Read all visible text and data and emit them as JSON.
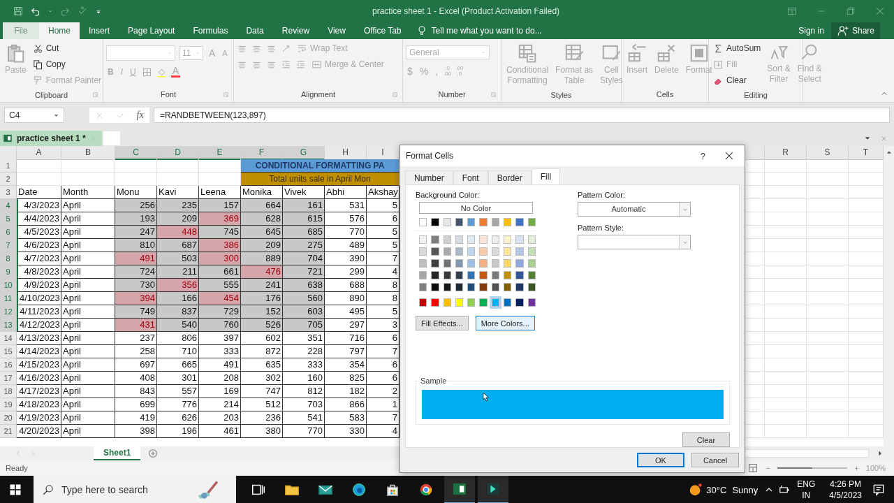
{
  "window": {
    "title": "practice sheet 1 - Excel (Product Activation Failed)"
  },
  "ribbon_tabs": [
    {
      "label": "File",
      "selected": false,
      "disabled": true
    },
    {
      "label": "Home",
      "selected": true,
      "disabled": false
    },
    {
      "label": "Insert",
      "selected": false,
      "disabled": false
    },
    {
      "label": "Page Layout",
      "selected": false,
      "disabled": false
    },
    {
      "label": "Formulas",
      "selected": false,
      "disabled": false
    },
    {
      "label": "Data",
      "selected": false,
      "disabled": false
    },
    {
      "label": "Review",
      "selected": false,
      "disabled": false
    },
    {
      "label": "View",
      "selected": false,
      "disabled": false
    },
    {
      "label": "Office Tab",
      "selected": false,
      "disabled": false
    }
  ],
  "tell_me": {
    "placeholder": "Tell me what you want to do..."
  },
  "account": {
    "sign_in": "Sign in",
    "share": "Share"
  },
  "ribbon": {
    "clipboard": {
      "label": "Clipboard",
      "paste": {
        "label": "Paste",
        "disabled": true
      },
      "items": [
        {
          "kind": "cut",
          "label": "Cut",
          "disabled": false
        },
        {
          "kind": "copy",
          "label": "Copy",
          "disabled": false
        },
        {
          "kind": "painter",
          "label": "Format Painter",
          "disabled": true
        }
      ]
    },
    "font": {
      "label": "Font",
      "size": "11",
      "size_buttons": [
        {
          "kind": "grow",
          "label": "A"
        },
        {
          "kind": "shrink",
          "label": "A"
        }
      ],
      "style_buttons": [
        {
          "kind": "bold",
          "label": "B"
        },
        {
          "kind": "italic",
          "label": "I"
        },
        {
          "kind": "underline",
          "label": "U"
        }
      ],
      "color_button": {
        "label": "A"
      }
    },
    "alignment": {
      "label": "Alignment",
      "wrap": {
        "label": "Wrap Text"
      },
      "merge": {
        "label": "Merge & Center"
      }
    },
    "number": {
      "label": "Number",
      "format": "General",
      "symbols": [
        {
          "label": "$"
        },
        {
          "label": "%"
        },
        {
          "label": ","
        }
      ],
      "decimals": [
        {
          "top": ".0",
          "bottom": ".00"
        },
        {
          "top": ".00",
          "bottom": ".0"
        }
      ]
    },
    "styles": {
      "label": "Styles",
      "items": [
        {
          "kind": "conditional",
          "label": "Conditional\nFormatting"
        },
        {
          "kind": "table",
          "label": "Format as\nTable"
        },
        {
          "kind": "cellstyles",
          "label": "Cell\nStyles"
        }
      ]
    },
    "cells": {
      "label": "Cells",
      "items": [
        {
          "kind": "insert",
          "label": "Insert"
        },
        {
          "kind": "delete",
          "label": "Delete"
        },
        {
          "kind": "format",
          "label": "Format"
        }
      ]
    },
    "editing": {
      "label": "Editing",
      "items": [
        {
          "kind": "autosum",
          "label": "AutoSum",
          "disabled": false
        },
        {
          "kind": "fill",
          "label": "Fill",
          "disabled": true
        },
        {
          "kind": "clear",
          "label": "Clear",
          "disabled": false
        }
      ],
      "big": [
        {
          "kind": "sort",
          "label": "Sort &\nFilter"
        },
        {
          "kind": "find",
          "label": "Find &\nSelect"
        }
      ]
    }
  },
  "formula_bar": {
    "name_box": "C4",
    "fx": "fx",
    "formula": "=RANDBETWEEN(123,897)"
  },
  "document_tab": {
    "title": "practice sheet 1 *"
  },
  "columns": [
    {
      "label": "A",
      "selected": false
    },
    {
      "label": "B",
      "selected": false
    },
    {
      "label": "C",
      "selected": true
    },
    {
      "label": "D",
      "selected": true
    },
    {
      "label": "E",
      "selected": true
    },
    {
      "label": "F",
      "selected": true
    },
    {
      "label": "G",
      "selected": true
    },
    {
      "label": "H",
      "selected": false
    },
    {
      "label": "I",
      "selected": false
    }
  ],
  "right_columns": [
    {
      "label": "R"
    },
    {
      "label": "S"
    },
    {
      "label": "T"
    }
  ],
  "banner_rows": [
    {
      "row": "1",
      "text": "CONDITIONAL FORMATTING PA",
      "color": "#5b9bd5"
    },
    {
      "row": "2",
      "text": "Total units sale in April Mon",
      "color": "#bf8f00"
    }
  ],
  "header_row": {
    "row": "3",
    "labels": [
      "Date",
      "Month",
      "Monu",
      "Kavi",
      "Leena",
      "Monika",
      "Vivek",
      "Abhi",
      "Akshay"
    ]
  },
  "rows": [
    {
      "row": "4",
      "selected": true,
      "date": "4/3/2023",
      "month": "April",
      "cells": [
        {
          "value": "256",
          "selected": true,
          "flagged": false
        },
        {
          "value": "235",
          "selected": true,
          "flagged": false
        },
        {
          "value": "157",
          "selected": true,
          "flagged": false
        },
        {
          "value": "664",
          "selected": true,
          "flagged": false
        },
        {
          "value": "161",
          "selected": true,
          "flagged": false
        },
        {
          "value": "531",
          "selected": false,
          "flagged": false
        },
        {
          "value": "5",
          "selected": false,
          "flagged": false
        }
      ]
    },
    {
      "row": "5",
      "selected": true,
      "date": "4/4/2023",
      "month": "April",
      "cells": [
        {
          "value": "193",
          "selected": true,
          "flagged": false
        },
        {
          "value": "209",
          "selected": true,
          "flagged": false
        },
        {
          "value": "369",
          "selected": true,
          "flagged": true
        },
        {
          "value": "628",
          "selected": true,
          "flagged": false
        },
        {
          "value": "615",
          "selected": true,
          "flagged": false
        },
        {
          "value": "576",
          "selected": false,
          "flagged": false
        },
        {
          "value": "6",
          "selected": false,
          "flagged": false
        }
      ]
    },
    {
      "row": "6",
      "selected": true,
      "date": "4/5/2023",
      "month": "April",
      "cells": [
        {
          "value": "247",
          "selected": true,
          "flagged": false
        },
        {
          "value": "448",
          "selected": true,
          "flagged": true
        },
        {
          "value": "745",
          "selected": true,
          "flagged": false
        },
        {
          "value": "645",
          "selected": true,
          "flagged": false
        },
        {
          "value": "685",
          "selected": true,
          "flagged": false
        },
        {
          "value": "770",
          "selected": false,
          "flagged": false
        },
        {
          "value": "5",
          "selected": false,
          "flagged": false
        }
      ]
    },
    {
      "row": "7",
      "selected": true,
      "date": "4/6/2023",
      "month": "April",
      "cells": [
        {
          "value": "810",
          "selected": true,
          "flagged": false
        },
        {
          "value": "687",
          "selected": true,
          "flagged": false
        },
        {
          "value": "386",
          "selected": true,
          "flagged": true
        },
        {
          "value": "209",
          "selected": true,
          "flagged": false
        },
        {
          "value": "275",
          "selected": true,
          "flagged": false
        },
        {
          "value": "489",
          "selected": false,
          "flagged": false
        },
        {
          "value": "5",
          "selected": false,
          "flagged": false
        }
      ]
    },
    {
      "row": "8",
      "selected": true,
      "date": "4/7/2023",
      "month": "April",
      "cells": [
        {
          "value": "491",
          "selected": true,
          "flagged": true
        },
        {
          "value": "503",
          "selected": true,
          "flagged": false
        },
        {
          "value": "300",
          "selected": true,
          "flagged": true
        },
        {
          "value": "889",
          "selected": true,
          "flagged": false
        },
        {
          "value": "704",
          "selected": true,
          "flagged": false
        },
        {
          "value": "390",
          "selected": false,
          "flagged": false
        },
        {
          "value": "7",
          "selected": false,
          "flagged": false
        }
      ]
    },
    {
      "row": "9",
      "selected": true,
      "date": "4/8/2023",
      "month": "April",
      "cells": [
        {
          "value": "724",
          "selected": true,
          "flagged": false
        },
        {
          "value": "211",
          "selected": true,
          "flagged": false
        },
        {
          "value": "661",
          "selected": true,
          "flagged": false
        },
        {
          "value": "476",
          "selected": true,
          "flagged": true
        },
        {
          "value": "721",
          "selected": true,
          "flagged": false
        },
        {
          "value": "299",
          "selected": false,
          "flagged": false
        },
        {
          "value": "4",
          "selected": false,
          "flagged": false
        }
      ]
    },
    {
      "row": "10",
      "selected": true,
      "date": "4/9/2023",
      "month": "April",
      "cells": [
        {
          "value": "730",
          "selected": true,
          "flagged": false
        },
        {
          "value": "356",
          "selected": true,
          "flagged": true
        },
        {
          "value": "555",
          "selected": true,
          "flagged": false
        },
        {
          "value": "241",
          "selected": true,
          "flagged": false
        },
        {
          "value": "638",
          "selected": true,
          "flagged": false
        },
        {
          "value": "688",
          "selected": false,
          "flagged": false
        },
        {
          "value": "8",
          "selected": false,
          "flagged": false
        }
      ]
    },
    {
      "row": "11",
      "selected": true,
      "date": "4/10/2023",
      "month": "April",
      "cells": [
        {
          "value": "394",
          "selected": true,
          "flagged": true
        },
        {
          "value": "166",
          "selected": true,
          "flagged": false
        },
        {
          "value": "454",
          "selected": true,
          "flagged": true
        },
        {
          "value": "176",
          "selected": true,
          "flagged": false
        },
        {
          "value": "560",
          "selected": true,
          "flagged": false
        },
        {
          "value": "890",
          "selected": false,
          "flagged": false
        },
        {
          "value": "8",
          "selected": false,
          "flagged": false
        }
      ]
    },
    {
      "row": "12",
      "selected": true,
      "date": "4/11/2023",
      "month": "April",
      "cells": [
        {
          "value": "749",
          "selected": true,
          "flagged": false
        },
        {
          "value": "837",
          "selected": true,
          "flagged": false
        },
        {
          "value": "729",
          "selected": true,
          "flagged": false
        },
        {
          "value": "152",
          "selected": true,
          "flagged": false
        },
        {
          "value": "603",
          "selected": true,
          "flagged": false
        },
        {
          "value": "495",
          "selected": false,
          "flagged": false
        },
        {
          "value": "5",
          "selected": false,
          "flagged": false
        }
      ]
    },
    {
      "row": "13",
      "selected": true,
      "date": "4/12/2023",
      "month": "April",
      "cells": [
        {
          "value": "431",
          "selected": true,
          "flagged": true
        },
        {
          "value": "540",
          "selected": true,
          "flagged": false
        },
        {
          "value": "760",
          "selected": true,
          "flagged": false
        },
        {
          "value": "526",
          "selected": true,
          "flagged": false
        },
        {
          "value": "705",
          "selected": true,
          "flagged": false
        },
        {
          "value": "297",
          "selected": false,
          "flagged": false
        },
        {
          "value": "3",
          "selected": false,
          "flagged": false
        }
      ]
    },
    {
      "row": "14",
      "selected": false,
      "date": "4/13/2023",
      "month": "April",
      "cells": [
        {
          "value": "237",
          "selected": false,
          "flagged": false
        },
        {
          "value": "806",
          "selected": false,
          "flagged": false
        },
        {
          "value": "397",
          "selected": false,
          "flagged": false
        },
        {
          "value": "602",
          "selected": false,
          "flagged": false
        },
        {
          "value": "351",
          "selected": false,
          "flagged": false
        },
        {
          "value": "716",
          "selected": false,
          "flagged": false
        },
        {
          "value": "6",
          "selected": false,
          "flagged": false
        }
      ]
    },
    {
      "row": "15",
      "selected": false,
      "date": "4/14/2023",
      "month": "April",
      "cells": [
        {
          "value": "258",
          "selected": false,
          "flagged": false
        },
        {
          "value": "710",
          "selected": false,
          "flagged": false
        },
        {
          "value": "333",
          "selected": false,
          "flagged": false
        },
        {
          "value": "872",
          "selected": false,
          "flagged": false
        },
        {
          "value": "228",
          "selected": false,
          "flagged": false
        },
        {
          "value": "797",
          "selected": false,
          "flagged": false
        },
        {
          "value": "7",
          "selected": false,
          "flagged": false
        }
      ]
    },
    {
      "row": "16",
      "selected": false,
      "date": "4/15/2023",
      "month": "April",
      "cells": [
        {
          "value": "697",
          "selected": false,
          "flagged": false
        },
        {
          "value": "665",
          "selected": false,
          "flagged": false
        },
        {
          "value": "491",
          "selected": false,
          "flagged": false
        },
        {
          "value": "635",
          "selected": false,
          "flagged": false
        },
        {
          "value": "333",
          "selected": false,
          "flagged": false
        },
        {
          "value": "354",
          "selected": false,
          "flagged": false
        },
        {
          "value": "6",
          "selected": false,
          "flagged": false
        }
      ]
    },
    {
      "row": "17",
      "selected": false,
      "date": "4/16/2023",
      "month": "April",
      "cells": [
        {
          "value": "408",
          "selected": false,
          "flagged": false
        },
        {
          "value": "301",
          "selected": false,
          "flagged": false
        },
        {
          "value": "208",
          "selected": false,
          "flagged": false
        },
        {
          "value": "302",
          "selected": false,
          "flagged": false
        },
        {
          "value": "160",
          "selected": false,
          "flagged": false
        },
        {
          "value": "825",
          "selected": false,
          "flagged": false
        },
        {
          "value": "6",
          "selected": false,
          "flagged": false
        }
      ]
    },
    {
      "row": "18",
      "selected": false,
      "date": "4/17/2023",
      "month": "April",
      "cells": [
        {
          "value": "843",
          "selected": false,
          "flagged": false
        },
        {
          "value": "557",
          "selected": false,
          "flagged": false
        },
        {
          "value": "169",
          "selected": false,
          "flagged": false
        },
        {
          "value": "747",
          "selected": false,
          "flagged": false
        },
        {
          "value": "812",
          "selected": false,
          "flagged": false
        },
        {
          "value": "182",
          "selected": false,
          "flagged": false
        },
        {
          "value": "2",
          "selected": false,
          "flagged": false
        }
      ]
    },
    {
      "row": "19",
      "selected": false,
      "date": "4/18/2023",
      "month": "April",
      "cells": [
        {
          "value": "699",
          "selected": false,
          "flagged": false
        },
        {
          "value": "776",
          "selected": false,
          "flagged": false
        },
        {
          "value": "214",
          "selected": false,
          "flagged": false
        },
        {
          "value": "512",
          "selected": false,
          "flagged": false
        },
        {
          "value": "703",
          "selected": false,
          "flagged": false
        },
        {
          "value": "866",
          "selected": false,
          "flagged": false
        },
        {
          "value": "1",
          "selected": false,
          "flagged": false
        }
      ]
    },
    {
      "row": "20",
      "selected": false,
      "date": "4/19/2023",
      "month": "April",
      "cells": [
        {
          "value": "419",
          "selected": false,
          "flagged": false
        },
        {
          "value": "626",
          "selected": false,
          "flagged": false
        },
        {
          "value": "203",
          "selected": false,
          "flagged": false
        },
        {
          "value": "236",
          "selected": false,
          "flagged": false
        },
        {
          "value": "541",
          "selected": false,
          "flagged": false
        },
        {
          "value": "583",
          "selected": false,
          "flagged": false
        },
        {
          "value": "7",
          "selected": false,
          "flagged": false
        }
      ]
    },
    {
      "row": "21",
      "selected": false,
      "date": "4/20/2023",
      "month": "April",
      "cells": [
        {
          "value": "398",
          "selected": false,
          "flagged": false
        },
        {
          "value": "196",
          "selected": false,
          "flagged": false
        },
        {
          "value": "461",
          "selected": false,
          "flagged": false
        },
        {
          "value": "380",
          "selected": false,
          "flagged": false
        },
        {
          "value": "770",
          "selected": false,
          "flagged": false
        },
        {
          "value": "330",
          "selected": false,
          "flagged": false
        },
        {
          "value": "4",
          "selected": false,
          "flagged": false
        }
      ]
    }
  ],
  "sheet_tabs": [
    {
      "label": "Sheet1",
      "selected": true
    }
  ],
  "status_bar": {
    "text": "Ready",
    "zoom": {
      "label": "100%",
      "level": 0.5
    }
  },
  "dialog": {
    "title": "Format Cells",
    "help": "?",
    "tabs": [
      {
        "label": "Number",
        "selected": false
      },
      {
        "label": "Font",
        "selected": false
      },
      {
        "label": "Border",
        "selected": false
      },
      {
        "label": "Fill",
        "selected": true
      }
    ],
    "background_label": "Background Color:",
    "no_color": "No Color",
    "theme_colors": [
      {
        "color": "#ffffff",
        "selected": false
      },
      {
        "color": "#000000",
        "selected": false
      },
      {
        "color": "#e7e6e6",
        "selected": false
      },
      {
        "color": "#44546a",
        "selected": false
      },
      {
        "color": "#5b9bd5",
        "selected": false
      },
      {
        "color": "#ed7d31",
        "selected": false
      },
      {
        "color": "#a5a5a5",
        "selected": false
      },
      {
        "color": "#ffc000",
        "selected": false
      },
      {
        "color": "#4472c4",
        "selected": false
      },
      {
        "color": "#70ad47",
        "selected": false
      }
    ],
    "tints": [
      {
        "swatches": [
          {
            "color": "#f2f2f2",
            "selected": false
          },
          {
            "color": "#7f7f7f",
            "selected": false
          },
          {
            "color": "#d0cece",
            "selected": false
          },
          {
            "color": "#d6dce4",
            "selected": false
          },
          {
            "color": "#ddebf7",
            "selected": false
          },
          {
            "color": "#fce4d6",
            "selected": false
          },
          {
            "color": "#ededed",
            "selected": false
          },
          {
            "color": "#fff2cc",
            "selected": false
          },
          {
            "color": "#d9e1f2",
            "selected": false
          },
          {
            "color": "#e2efda",
            "selected": false
          }
        ]
      },
      {
        "swatches": [
          {
            "color": "#d9d9d9",
            "selected": false
          },
          {
            "color": "#595959",
            "selected": false
          },
          {
            "color": "#aeaaaa",
            "selected": false
          },
          {
            "color": "#acb9ca",
            "selected": false
          },
          {
            "color": "#bdd7ee",
            "selected": false
          },
          {
            "color": "#f8cbad",
            "selected": false
          },
          {
            "color": "#dbdbdb",
            "selected": false
          },
          {
            "color": "#ffe699",
            "selected": false
          },
          {
            "color": "#b4c6e7",
            "selected": false
          },
          {
            "color": "#c6e0b4",
            "selected": false
          }
        ]
      },
      {
        "swatches": [
          {
            "color": "#bfbfbf",
            "selected": false
          },
          {
            "color": "#404040",
            "selected": false
          },
          {
            "color": "#757171",
            "selected": false
          },
          {
            "color": "#8497b0",
            "selected": false
          },
          {
            "color": "#9bc2e6",
            "selected": false
          },
          {
            "color": "#f4b084",
            "selected": false
          },
          {
            "color": "#c9c9c9",
            "selected": false
          },
          {
            "color": "#ffd966",
            "selected": false
          },
          {
            "color": "#8ea9db",
            "selected": false
          },
          {
            "color": "#a9d08e",
            "selected": false
          }
        ]
      },
      {
        "swatches": [
          {
            "color": "#a6a6a6",
            "selected": false
          },
          {
            "color": "#262626",
            "selected": false
          },
          {
            "color": "#3a3838",
            "selected": false
          },
          {
            "color": "#333f4f",
            "selected": false
          },
          {
            "color": "#2f75b5",
            "selected": false
          },
          {
            "color": "#c65911",
            "selected": false
          },
          {
            "color": "#7b7b7b",
            "selected": false
          },
          {
            "color": "#bf8f00",
            "selected": false
          },
          {
            "color": "#305496",
            "selected": false
          },
          {
            "color": "#548235",
            "selected": false
          }
        ]
      },
      {
        "swatches": [
          {
            "color": "#808080",
            "selected": false
          },
          {
            "color": "#0d0d0d",
            "selected": false
          },
          {
            "color": "#161616",
            "selected": false
          },
          {
            "color": "#222b35",
            "selected": false
          },
          {
            "color": "#1f4e78",
            "selected": false
          },
          {
            "color": "#833c0c",
            "selected": false
          },
          {
            "color": "#525252",
            "selected": false
          },
          {
            "color": "#806000",
            "selected": false
          },
          {
            "color": "#203764",
            "selected": false
          },
          {
            "color": "#375623",
            "selected": false
          }
        ]
      }
    ],
    "standard_colors": [
      {
        "color": "#c00000",
        "selected": false
      },
      {
        "color": "#ff0000",
        "selected": false
      },
      {
        "color": "#ffc000",
        "selected": false
      },
      {
        "color": "#ffff00",
        "selected": false
      },
      {
        "color": "#92d050",
        "selected": false
      },
      {
        "color": "#00b050",
        "selected": false
      },
      {
        "color": "#00b0f0",
        "selected": true
      },
      {
        "color": "#0070c0",
        "selected": false
      },
      {
        "color": "#002060",
        "selected": false
      },
      {
        "color": "#7030a0",
        "selected": false
      }
    ],
    "fill_effects": {
      "label": "Fill Effects...",
      "focused": false
    },
    "more_colors": {
      "label": "More Colors...",
      "focused": true
    },
    "pattern_color_label": "Pattern Color:",
    "pattern_color": "Automatic",
    "pattern_style_label": "Pattern Style:",
    "sample_label": "Sample",
    "buttons": [
      {
        "kind": "clear",
        "label": "Clear",
        "default": false
      },
      {
        "kind": "ok",
        "label": "OK",
        "default": true
      },
      {
        "kind": "cancel",
        "label": "Cancel",
        "default": false
      }
    ]
  },
  "taskbar": {
    "search_placeholder": "Type here to search",
    "apps": [
      {
        "kind": "taskview",
        "active": false
      },
      {
        "kind": "folder",
        "active": false
      },
      {
        "kind": "mail",
        "active": false
      },
      {
        "kind": "edge",
        "active": false
      },
      {
        "kind": "store",
        "active": false
      },
      {
        "kind": "chrome",
        "active": false
      },
      {
        "kind": "excel",
        "active": true
      },
      {
        "kind": "editor",
        "active": true
      }
    ],
    "weather": {
      "temperature": "30°C",
      "condition": "Sunny"
    },
    "language": {
      "top": "ENG",
      "bottom": "IN"
    },
    "time": "4:26 PM",
    "date": "4/5/2023"
  }
}
